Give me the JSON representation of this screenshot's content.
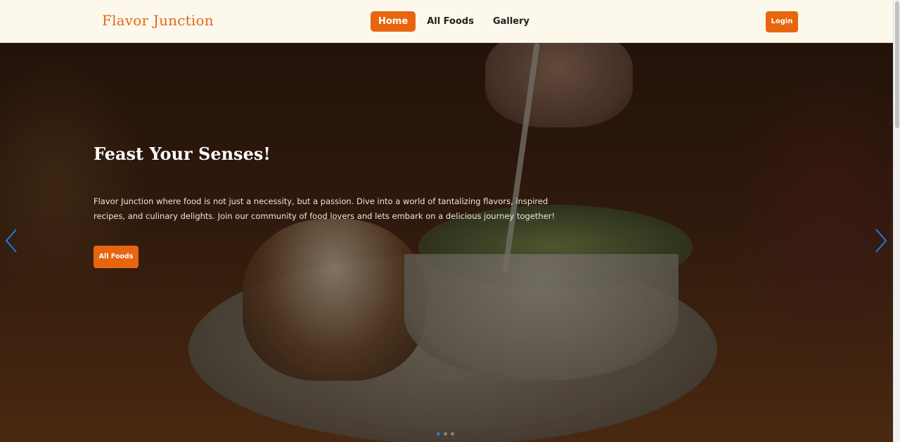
{
  "header": {
    "logo": "Flavor Junction",
    "nav": [
      {
        "label": "Home",
        "active": true
      },
      {
        "label": "All Foods",
        "active": false
      },
      {
        "label": "Gallery",
        "active": false
      }
    ],
    "login_label": "Login"
  },
  "hero": {
    "title": "Feast Your Senses!",
    "description": "Flavor Junction where food is not just a necessity, but a passion. Dive into a world of tantalizing flavors, inspired recipes, and culinary delights. Join our community of food lovers and lets embark on a delicious journey together!",
    "cta_label": "All Foods"
  },
  "carousel": {
    "slide_count": 3,
    "active_index": 0
  },
  "colors": {
    "accent": "#e8650f",
    "logo": "#e2691a",
    "navbar_bg": "#fdf8ec",
    "arrow": "#1a7be8"
  },
  "icons": {
    "prev": "chevron-left-icon",
    "next": "chevron-right-icon"
  }
}
